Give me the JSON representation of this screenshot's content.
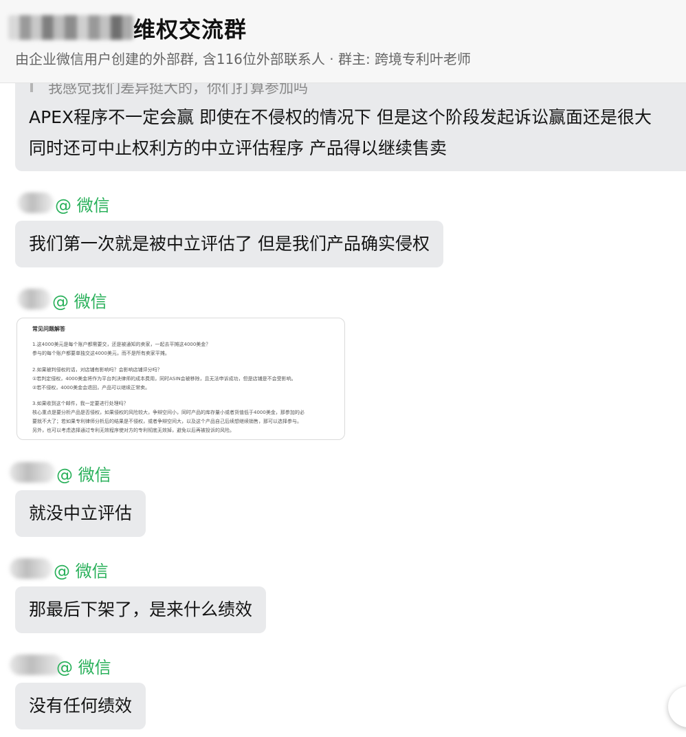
{
  "header": {
    "group_name": "维权交流群",
    "group_info": "由企业微信用户创建的外部群, 含116位外部联系人 · 群主: 跨境专利叶老师"
  },
  "messages": [
    {
      "quote": "我感觉我们差异挺大的，你们打算参加吗",
      "lines": [
        "APEX程序不一定会赢  即使在不侵权的情况下 但是这个阶段发起诉讼赢面还是很大",
        "同时还可中止权利方的中立评估程序  产品得以继续售卖"
      ]
    },
    {
      "sender_suffix": "@ 微信",
      "text": "我们第一次就是被中立评估了 但是我们产品确实侵权"
    },
    {
      "sender_suffix": "@ 微信",
      "doc": {
        "title": "常见问题解答",
        "lines": [
          "1.这4000美元是每个账户都需要交，还是被通知的卖家，一起去平摊这4000美金？",
          "参与的每个账户都要单独交这4000美元，而不是所有卖家平摊。",
          "2.如果被判侵权的话，对店铺有影响吗？会影响店铺评分吗？",
          "①若判定侵权，4000美金将作为平台判决律师的成本费用，同时ASIN会被移除，且无法申诉成功，但是店铺是不会受影响。",
          "②若不侵权，4000美金会退回，产品可以继续正常卖。",
          "3.如果收到这个邮件，我一定要进行处理吗？",
          "核心重点是要分析产品是否侵权，如果侵权的风险较大，争辩空间小，同时产品的库存量小或者货值低于4000美金，那参加的必",
          "要就不大了；若如果专利律师分析后的结果是不侵权，或者争辩空间大，以及这个产品自己后续想继续销售，那可以选择参与。",
          "另外，也可以考虑选择通过专利无效程序使对方的专利彻底无效掉，避免以后再被投诉的风险。"
        ]
      }
    },
    {
      "sender_suffix": "@ 微信",
      "text": "就没中立评估"
    },
    {
      "sender_suffix": "@ 微信",
      "text": "那最后下架了，是来什么绩效"
    },
    {
      "sender_suffix": "@ 微信",
      "text": "没有任何绩效"
    }
  ]
}
